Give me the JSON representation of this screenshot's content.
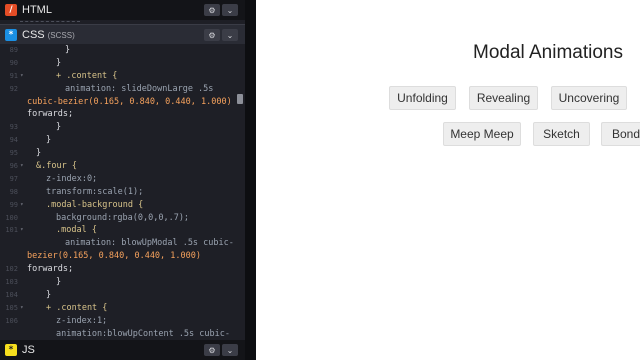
{
  "editor": {
    "html_panel": {
      "name": "HTML",
      "icon": "html-icon"
    },
    "css_panel": {
      "name": "CSS",
      "sub": "(SCSS)",
      "icon": "css-icon"
    },
    "js_panel": {
      "name": "JS",
      "icon": "js-icon"
    },
    "controls": {
      "settings_icon": "⚙",
      "collapse_icon": "⌄"
    },
    "line_numbers": [
      "89",
      "90",
      "91",
      "92",
      "",
      "",
      "93",
      "94",
      "95",
      "96",
      "97",
      "98",
      "99",
      "100",
      "101",
      "",
      "",
      "102",
      "103",
      "104",
      "105",
      "106",
      ""
    ],
    "code_lines": [
      "}",
      "}",
      "+ .content {",
      "animation: slideDownLarge .5s",
      "cubic-bezier(0.165, 0.840, 0.440, 1.000)",
      "forwards;",
      "}",
      "}",
      "}",
      "&.four {",
      "z-index:0;",
      "transform:scale(1);",
      ".modal-background {",
      "background:rgba(0,0,0,.7);",
      ".modal {",
      "animation: blowUpModal .5s cubic-",
      "bezier(0.165, 0.840, 0.440, 1.000)",
      "forwards;",
      "}",
      "}",
      "+ .content {",
      "z-index:1;",
      "animation:blowUpContent .5s cubic-"
    ]
  },
  "preview": {
    "title": "Modal Animations",
    "buttons": [
      "Unfolding",
      "Revealing",
      "Uncovering",
      "Meep Meep",
      "Sketch",
      "Bond"
    ]
  }
}
